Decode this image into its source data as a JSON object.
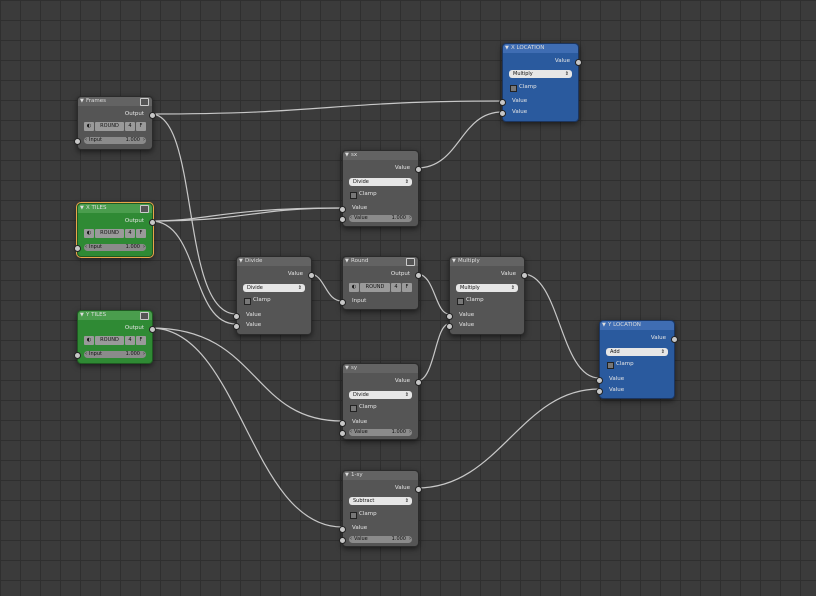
{
  "nodes": {
    "frames": {
      "title": "Frames",
      "output": "Output",
      "round_label": "ROUND",
      "round_digits": "4",
      "f_label": "F",
      "input_label": "Input",
      "input_value": "1.000"
    },
    "xtiles": {
      "title": "X TILES",
      "output": "Output",
      "round_label": "ROUND",
      "round_digits": "4",
      "f_label": "F",
      "input_label": "Input",
      "input_value": "1.000"
    },
    "ytiles": {
      "title": "Y TILES",
      "output": "Output",
      "round_label": "ROUND",
      "round_digits": "4",
      "f_label": "F",
      "input_label": "Input",
      "input_value": "1.000"
    },
    "xlocation": {
      "title": "X LOCATION",
      "out": "Value",
      "op": "Multiply",
      "clamp": "Clamp",
      "in1": "Value",
      "in2": "Value"
    },
    "sx": {
      "title": "sx",
      "out": "Value",
      "op": "Divide",
      "clamp": "Clamp",
      "in1": "Value",
      "in2_label": "Value",
      "in2_value": "1.000"
    },
    "divide": {
      "title": "Divide",
      "out": "Value",
      "op": "Divide",
      "clamp": "Clamp",
      "in1": "Value",
      "in2": "Value"
    },
    "round": {
      "title": "Round",
      "output": "Output",
      "round_label": "ROUND",
      "round_digits": "4",
      "f_label": "F",
      "input": "Input"
    },
    "multiply": {
      "title": "Multiply",
      "out": "Value",
      "op": "Multiply",
      "clamp": "Clamp",
      "in1": "Value",
      "in2": "Value"
    },
    "ylocation": {
      "title": "Y LOCATION",
      "out": "Value",
      "op": "Add",
      "clamp": "Clamp",
      "in1": "Value",
      "in2": "Value"
    },
    "sy": {
      "title": "sy",
      "out": "Value",
      "op": "Divide",
      "clamp": "Clamp",
      "in1": "Value",
      "in2_label": "Value",
      "in2_value": "1.000"
    },
    "one_minus_sy": {
      "title": "1-sy",
      "out": "Value",
      "op": "Subtract",
      "clamp": "Clamp",
      "in1": "Value",
      "in2_label": "Value",
      "in2_value": "1.000"
    }
  },
  "colors": {
    "link": "#c8c8c8",
    "grey_node": "#555555",
    "blue_node": "#2a5a9e",
    "green_node": "#2f8a34",
    "selected_outline": "#e8a54a"
  }
}
